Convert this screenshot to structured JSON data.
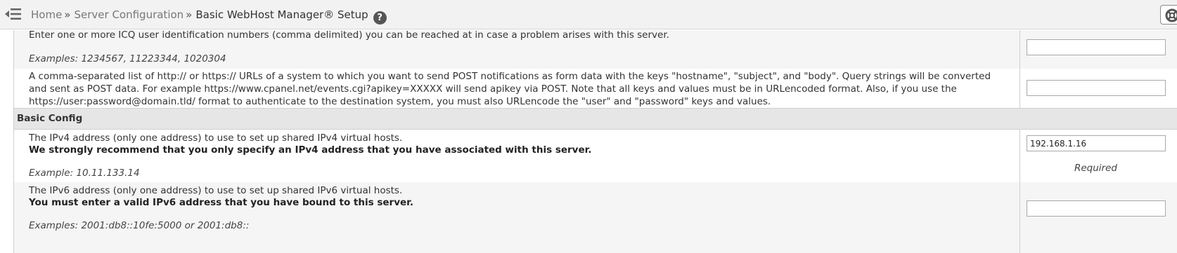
{
  "header": {
    "breadcrumb": {
      "home": "Home",
      "server_configuration": "Server Configuration",
      "separator": "»",
      "current": "Basic WebHost Manager® Setup"
    },
    "help_icon": "?",
    "icons": {
      "menu_toggle": "menu-collapse-icon",
      "support": "life-ring-icon",
      "help": "question-circle-icon"
    }
  },
  "settings": {
    "icq": {
      "description": "Enter one or more ICQ user identification numbers (comma delimited) you can be reached at in case a problem arises with this server.",
      "example": "Examples: 1234567, 11223344, 1020304",
      "value": ""
    },
    "post_urls": {
      "description": "A comma-separated list of http:// or https:// URLs of a system to which you want to send POST notifications as form data with the keys \"hostname\", \"subject\", and \"body\". Query strings will be converted and sent as POST data. For example https://www.cpanel.net/events.cgi?apikey=XXXXX will send apikey via POST. Note that all keys and values must be in URLencoded format. Also, if you use the https://user:password@domain.tld/ format to authenticate to the destination system, you must also URLencode the \"user\" and \"password\" keys and values.",
      "value": ""
    }
  },
  "basic_config": {
    "title": "Basic Config",
    "ipv4": {
      "description": "The IPv4 address (only one address) to use to set up shared IPv4 virtual hosts.",
      "note": "We strongly recommend that you only specify an IPv4 address that you have associated with this server.",
      "example": "Example: 10.11.133.14",
      "value": "192.168.1.16",
      "required_label": "Required"
    },
    "ipv6": {
      "description": "The IPv6 address (only one address) to use to set up shared IPv6 virtual hosts.",
      "note": "You must enter a valid IPv6 address that you have bound to this server.",
      "example": "Examples: 2001:db8::10fe:5000 or 2001:db8::",
      "value": ""
    }
  },
  "colors": {
    "topbar_bg": "#f2f2f2",
    "row_gray": "#f5f5f5",
    "section_bg": "#e6e6e6"
  }
}
